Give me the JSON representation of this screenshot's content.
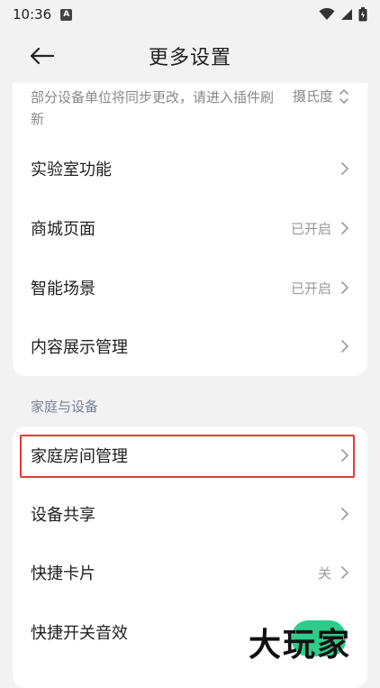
{
  "status_bar": {
    "time": "10:36",
    "notification_icon": "A",
    "icons": [
      "wifi-icon",
      "signal-icon",
      "battery-icon"
    ]
  },
  "header": {
    "title": "更多设置",
    "back_icon": "arrow-left-icon"
  },
  "general_card": {
    "unit_note": "部分设备单位将同步更改，请进入插件刷新",
    "unit_value": "摄氏度",
    "items": [
      {
        "label": "实验室功能",
        "value": ""
      },
      {
        "label": "商城页面",
        "value": "已开启"
      },
      {
        "label": "智能场景",
        "value": "已开启"
      },
      {
        "label": "内容展示管理",
        "value": ""
      }
    ]
  },
  "home_section": {
    "title": "家庭与设备",
    "items": [
      {
        "label": "家庭房间管理",
        "value": ""
      },
      {
        "label": "设备共享",
        "value": ""
      },
      {
        "label": "快捷卡片",
        "value": "关"
      },
      {
        "label": "快捷开关音效",
        "value": ""
      }
    ]
  },
  "watermark": {
    "text": "大玩家"
  },
  "colors": {
    "background": "#f2f2f2",
    "card": "#ffffff",
    "highlight": "#e53935",
    "section_title": "#7a7f99",
    "watermark_accent": "#2ecc8a"
  }
}
